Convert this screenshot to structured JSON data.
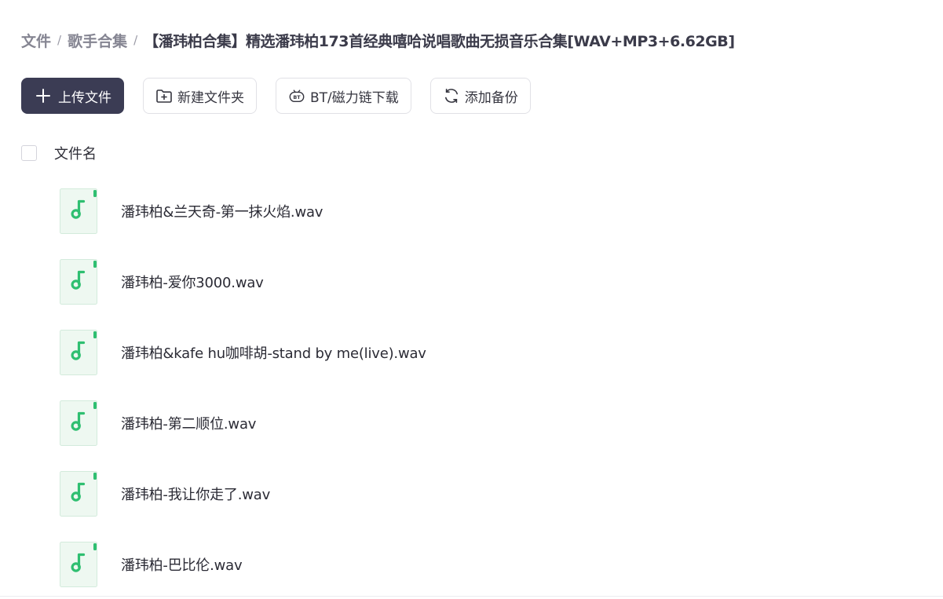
{
  "breadcrumb": {
    "root": "文件",
    "parent": "歌手合集",
    "separator": "/",
    "current": "【潘玮柏合集】精选潘玮柏173首经典嘻哈说唱歌曲无损音乐合集[WAV+MP3+6.62GB]"
  },
  "toolbar": {
    "upload_label": "上传文件",
    "new_folder_label": "新建文件夹",
    "bt_label": "BT/磁力链下载",
    "backup_label": "添加备份"
  },
  "list": {
    "column_filename": "文件名",
    "files": [
      {
        "name": "潘玮柏&兰天奇-第一抹火焰.wav",
        "icon": "music-file-icon"
      },
      {
        "name": "潘玮柏-爱你3000.wav",
        "icon": "music-file-icon"
      },
      {
        "name": "潘玮柏&kafe hu咖啡胡-stand by me(live).wav",
        "icon": "music-file-icon"
      },
      {
        "name": "潘玮柏-第二顺位.wav",
        "icon": "music-file-icon"
      },
      {
        "name": "潘玮柏-我让你走了.wav",
        "icon": "music-file-icon"
      },
      {
        "name": "潘玮柏-巴比伦.wav",
        "icon": "music-file-icon"
      }
    ]
  },
  "colors": {
    "primary_button": "#3b3c54",
    "music_icon_green": "#2fbf71",
    "file_icon_bg": "#eef8f1"
  }
}
